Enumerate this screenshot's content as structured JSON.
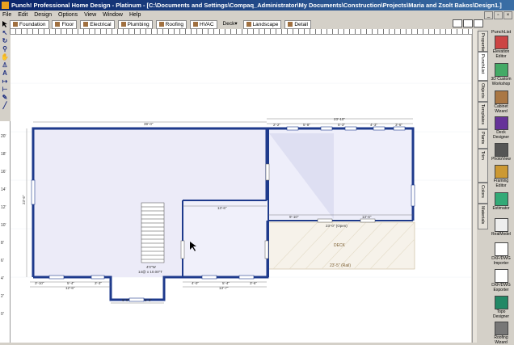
{
  "window": {
    "title": "Punch! Professional Home Design - Platinum - [C:\\Documents and Settings\\Compaq_Administrator\\My Documents\\Construction\\Projects\\Maria and Zsolt Bakos\\Design1.]"
  },
  "menu": [
    "File",
    "Edit",
    "Design",
    "Options",
    "View",
    "Window",
    "Help"
  ],
  "tabs": [
    "Foundation",
    "Floor",
    "Electrical",
    "Plumbing",
    "Roofing",
    "HVAC",
    "Deck",
    "Landscape",
    "Detail"
  ],
  "right_panel": {
    "header": "PunchList",
    "vertical_tabs": [
      "Properties",
      "PunchList",
      "Objects",
      "Templates",
      "Plants",
      "Trim",
      "Colors",
      "Materials"
    ],
    "tools": [
      {
        "label": "Elevation Editor",
        "icon": "elevation-icon"
      },
      {
        "label": "3D Custom Workshop",
        "icon": "workshop-icon"
      },
      {
        "label": "Cabinet Wizard",
        "icon": "cabinet-icon"
      },
      {
        "label": "Deck Designer",
        "icon": "deck-icon"
      },
      {
        "label": "PhotoView",
        "icon": "camera-icon"
      },
      {
        "label": "Framing Editor",
        "icon": "framing-icon"
      },
      {
        "label": "Estimator",
        "icon": "calculator-icon"
      },
      {
        "label": "RealModel",
        "icon": "model-icon"
      },
      {
        "label": "DXF/DWG Importer",
        "icon": "import-icon"
      },
      {
        "label": "DXF/DWG Exporter",
        "icon": "export-icon"
      },
      {
        "label": "Topo Designer",
        "icon": "topo-icon"
      },
      {
        "label": "Roofing Wizard",
        "icon": "roof-icon"
      }
    ]
  },
  "ruler_left": [
    "20'",
    "18'",
    "16'",
    "14'",
    "12'",
    "10'",
    "8'",
    "6'",
    "4'",
    "2'",
    "0'"
  ],
  "plan": {
    "dims": {
      "left_overall": "39'-0\"",
      "right_overall": "23'-10\"",
      "right_top": [
        "2'-2\"",
        "5'-8\"",
        "5'-3\"",
        "4'-3\"",
        "3'-6\""
      ],
      "left_height": "23'-6\"",
      "inner_width": "13'-6\"",
      "stair_label": "4'0\"W",
      "stair_run": "14@ x 10.00\"T",
      "deck_top": "23'-0\" (Open)",
      "deck_bottom": "23'-5\" (Rail)",
      "right_room_bottom": [
        "9'-10\"",
        "13'-6\""
      ],
      "bottom_left": [
        "3'-10\"",
        "5'-4\"",
        "3'-3\""
      ],
      "bottom_left_total": "12'-6\"",
      "bottom_mid": [
        "4'-0\"",
        "5'-4\"",
        "3'-6\""
      ],
      "bottom_mid_total": "13'-7\"",
      "bay": [
        "6'-0\"",
        "5'-0\""
      ]
    },
    "labels": {
      "deck": "DECK"
    }
  }
}
